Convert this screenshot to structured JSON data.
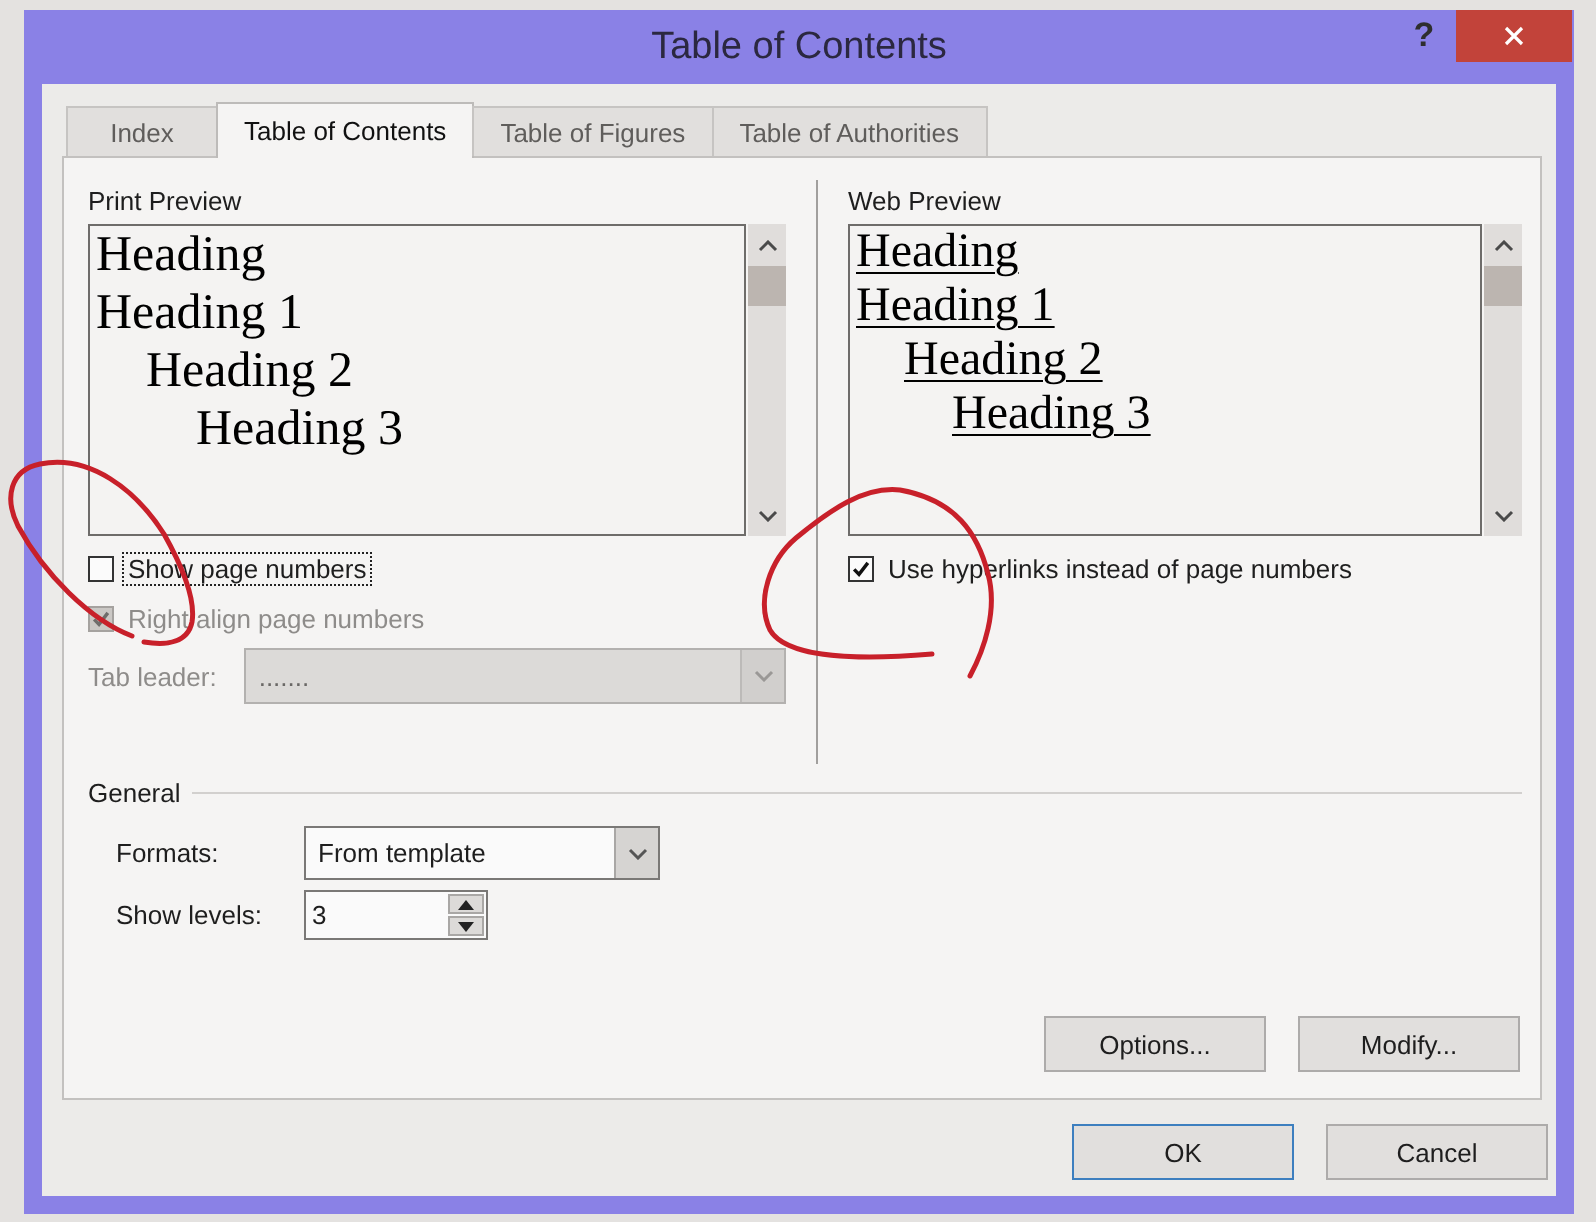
{
  "window": {
    "title": "Table of Contents",
    "help_button": "?"
  },
  "tabs": [
    {
      "label": "Index",
      "selected": false
    },
    {
      "label": "Table of Contents",
      "selected": true
    },
    {
      "label": "Table of Figures",
      "selected": false
    },
    {
      "label": "Table of Authorities",
      "selected": false
    }
  ],
  "print_preview": {
    "kind": "print",
    "label": "Print Preview",
    "headings": [
      {
        "text": "Heading"
      },
      {
        "text": "Heading 1",
        "children": [
          {
            "text": "Heading 2",
            "children": [
              {
                "text": "Heading 3"
              }
            ]
          }
        ]
      }
    ],
    "options": [
      {
        "label": "Show page numbers",
        "checked": false,
        "disabled": false,
        "focused": true
      },
      {
        "label": "Right align page numbers",
        "checked": true,
        "disabled": true,
        "focused": false
      }
    ],
    "tab_leader": {
      "label": "Tab leader:",
      "value": ".......",
      "disabled": true
    }
  },
  "web_preview": {
    "kind": "web",
    "label": "Web Preview",
    "headings": [
      {
        "text": "Heading"
      },
      {
        "text": "Heading 1",
        "children": [
          {
            "text": "Heading 2",
            "children": [
              {
                "text": "Heading 3"
              }
            ]
          }
        ]
      }
    ],
    "options": [
      {
        "label": "Use hyperlinks instead of page numbers",
        "checked": true,
        "disabled": false,
        "focused": false
      }
    ]
  },
  "general": {
    "label": "General",
    "fields": [
      {
        "kind": "dropdown",
        "label": "Formats:",
        "value": "From template",
        "disabled": false
      },
      {
        "kind": "spinner",
        "label": "Show levels:",
        "value": "3"
      }
    ]
  },
  "panel_buttons": [
    {
      "label": "Options..."
    },
    {
      "label": "Modify..."
    }
  ],
  "dialog_buttons": [
    {
      "label": "OK",
      "default": true
    },
    {
      "label": "Cancel",
      "default": false
    }
  ]
}
